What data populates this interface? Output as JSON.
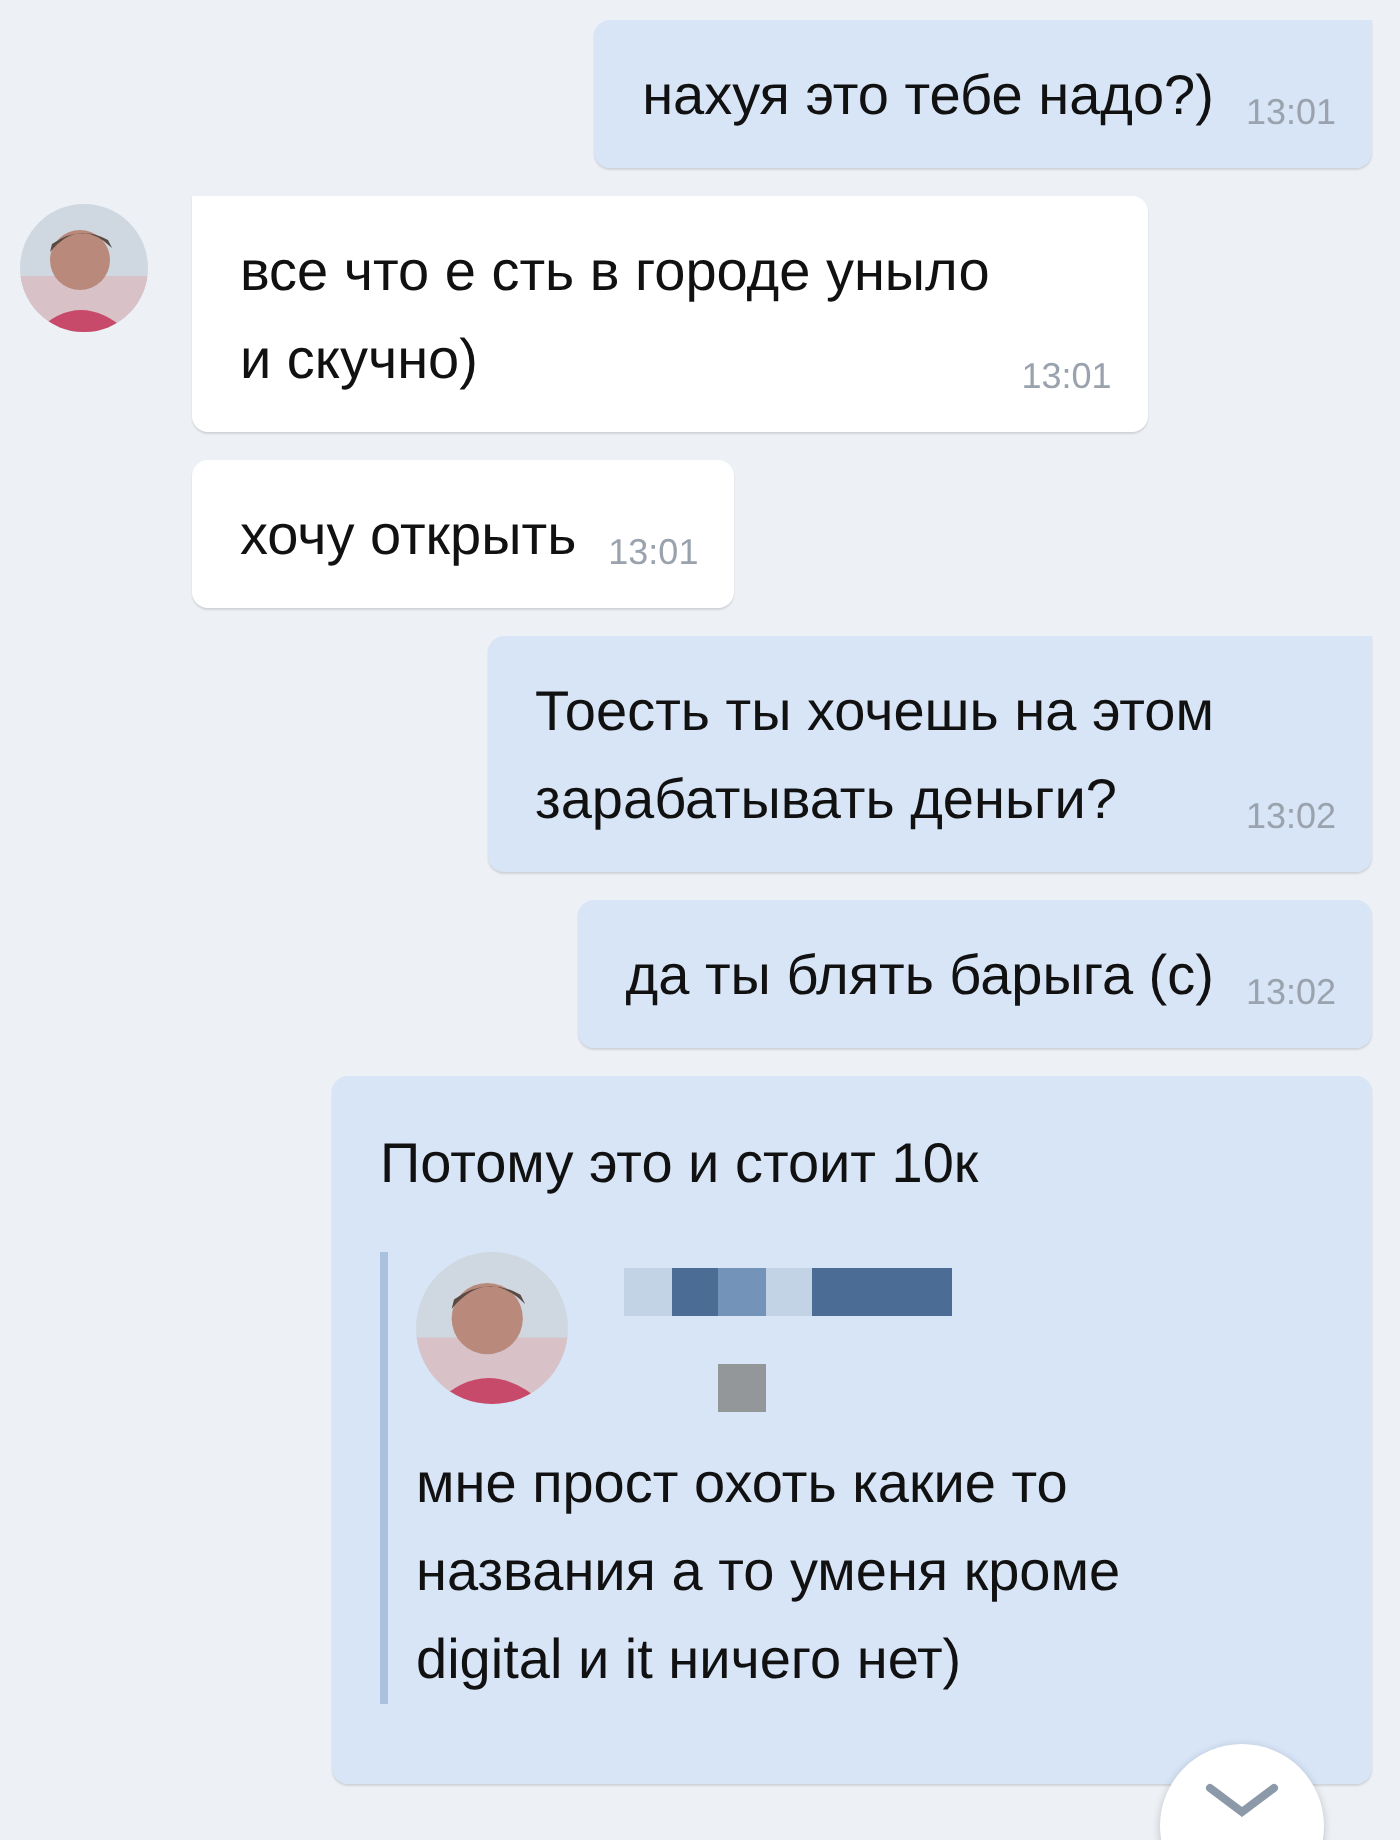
{
  "messages": [
    {
      "kind": "out",
      "lines": [
        "нахуя это тебе надо?)"
      ],
      "time": "13:01"
    },
    {
      "kind": "in",
      "avatar": true,
      "lines": [
        "все что е сть в городе уныло",
        "и скучно)"
      ],
      "time": "13:01"
    },
    {
      "kind": "in",
      "avatar": false,
      "lines": [
        "хочу открыть"
      ],
      "time": "13:01"
    },
    {
      "kind": "out",
      "lines": [
        "Тоесть ты хочешь на этом",
        "зарабатывать деньги?"
      ],
      "time": "13:02"
    },
    {
      "kind": "out",
      "lines": [
        "да ты блять барыга (с)"
      ],
      "time": "13:02"
    },
    {
      "kind": "forward",
      "lines": [
        "Потому это и стоит 10к"
      ],
      "quote": {
        "lines": [
          "мне прост охоть какие то",
          "названия а то уменя кроме",
          "digital и it ничего нет)"
        ]
      }
    }
  ]
}
